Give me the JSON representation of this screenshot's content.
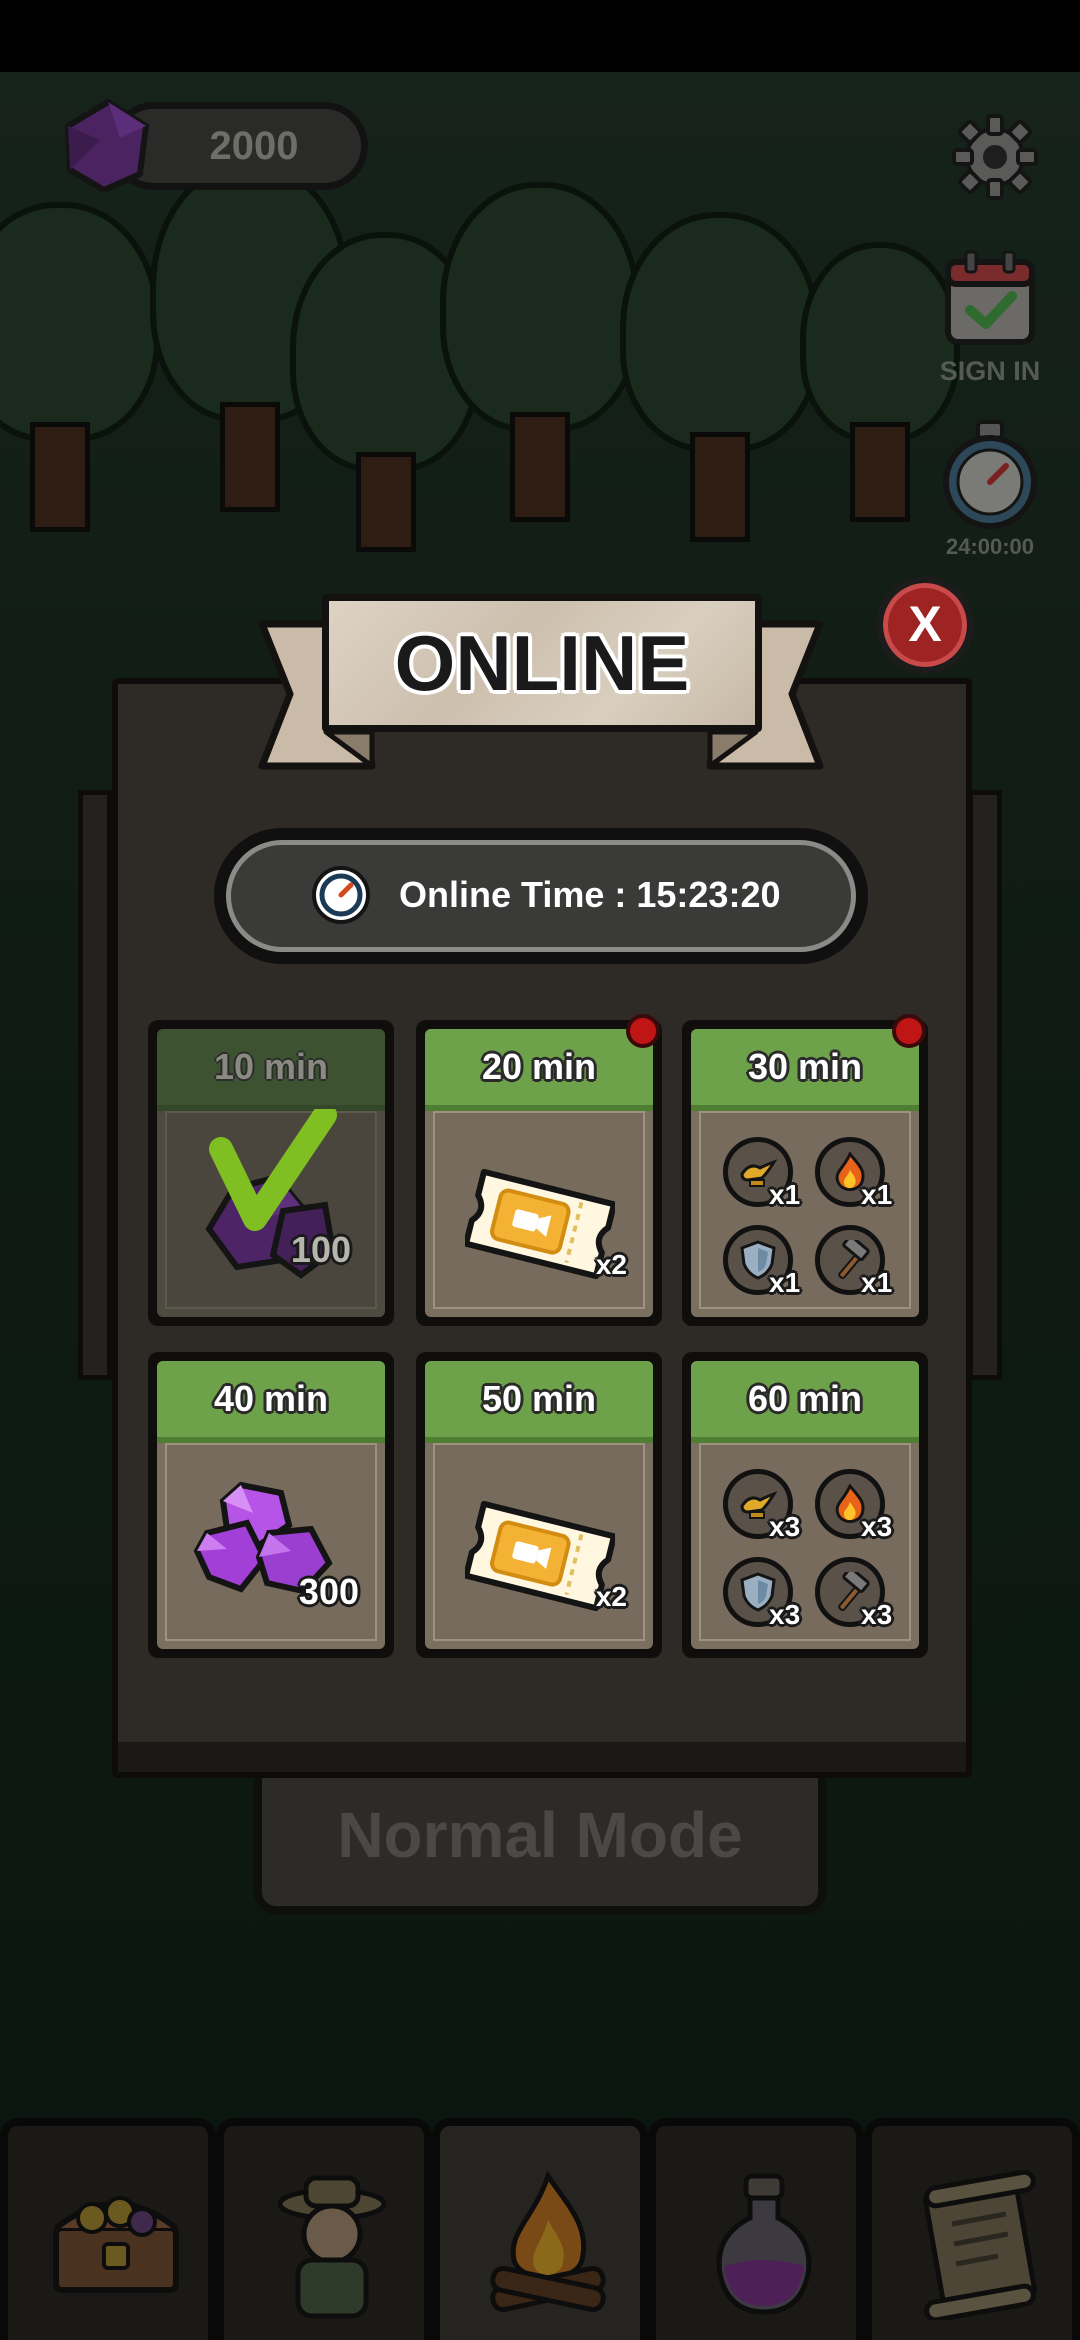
{
  "hud": {
    "gem_count": "2000",
    "sign_in_label": "SIGN IN",
    "online_timer": "24:00:00",
    "icons": [
      "gem-icon",
      "gear-icon",
      "calendar-check-icon",
      "stopwatch-icon"
    ]
  },
  "main": {
    "mode_button_label": "Normal Mode"
  },
  "bottom_nav": {
    "items": [
      "treasure-chest-icon",
      "farmer-character-icon",
      "campfire-icon",
      "potion-icon",
      "scroll-icon"
    ],
    "active_index": 2
  },
  "modal": {
    "title": "ONLINE",
    "close_label": "X",
    "online_time_text": "Online Time : 15:23:20",
    "rewards": [
      {
        "time": "10 min",
        "claimed": true,
        "has_notification": false,
        "items": [
          {
            "icon": "purple-gem-icon",
            "qty": "100"
          }
        ]
      },
      {
        "time": "20 min",
        "claimed": false,
        "has_notification": true,
        "items": [
          {
            "icon": "video-ticket-icon",
            "qty": "x2"
          }
        ]
      },
      {
        "time": "30 min",
        "claimed": false,
        "has_notification": true,
        "items": [
          {
            "icon": "magic-lamp-icon",
            "qty": "x1"
          },
          {
            "icon": "fire-icon",
            "qty": "x1"
          },
          {
            "icon": "shield-icon",
            "qty": "x1"
          },
          {
            "icon": "hammer-icon",
            "qty": "x1"
          }
        ]
      },
      {
        "time": "40 min",
        "claimed": false,
        "has_notification": false,
        "items": [
          {
            "icon": "purple-gem-pile-icon",
            "qty": "300"
          }
        ]
      },
      {
        "time": "50 min",
        "claimed": false,
        "has_notification": false,
        "items": [
          {
            "icon": "video-ticket-icon",
            "qty": "x2"
          }
        ]
      },
      {
        "time": "60 min",
        "claimed": false,
        "has_notification": false,
        "items": [
          {
            "icon": "magic-lamp-icon",
            "qty": "x3"
          },
          {
            "icon": "fire-icon",
            "qty": "x3"
          },
          {
            "icon": "shield-icon",
            "qty": "x3"
          },
          {
            "icon": "hammer-icon",
            "qty": "x3"
          }
        ]
      }
    ]
  },
  "colors": {
    "card_header_green": "#6ea24a",
    "card_body": "#7b7060",
    "modal_bg": "#2e2a25",
    "close_red": "#9e2424",
    "notification_red": "#c01515",
    "gem_purple": "#9b3fd0",
    "check_green": "#8fd42a"
  }
}
